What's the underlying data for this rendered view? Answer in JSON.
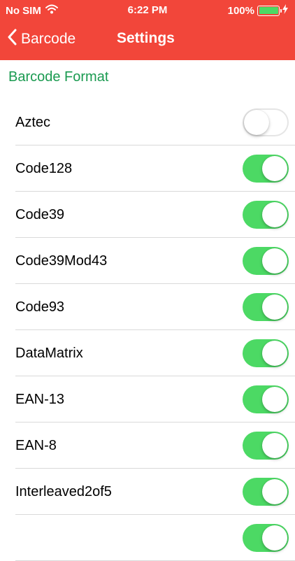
{
  "status_bar": {
    "carrier": "No SIM",
    "time": "6:22 PM",
    "battery": "100%"
  },
  "nav": {
    "back_label": "Barcode",
    "title": "Settings"
  },
  "section": {
    "title": "Barcode Format"
  },
  "formats": [
    {
      "label": "Aztec",
      "enabled": false
    },
    {
      "label": "Code128",
      "enabled": true
    },
    {
      "label": "Code39",
      "enabled": true
    },
    {
      "label": "Code39Mod43",
      "enabled": true
    },
    {
      "label": "Code93",
      "enabled": true
    },
    {
      "label": "DataMatrix",
      "enabled": true
    },
    {
      "label": "EAN-13",
      "enabled": true
    },
    {
      "label": "EAN-8",
      "enabled": true
    },
    {
      "label": "Interleaved2of5",
      "enabled": true
    },
    {
      "label": "",
      "enabled": true
    }
  ],
  "colors": {
    "accent": "#f2463a",
    "section_text": "#1a9a50",
    "toggle_on": "#4cd964"
  }
}
